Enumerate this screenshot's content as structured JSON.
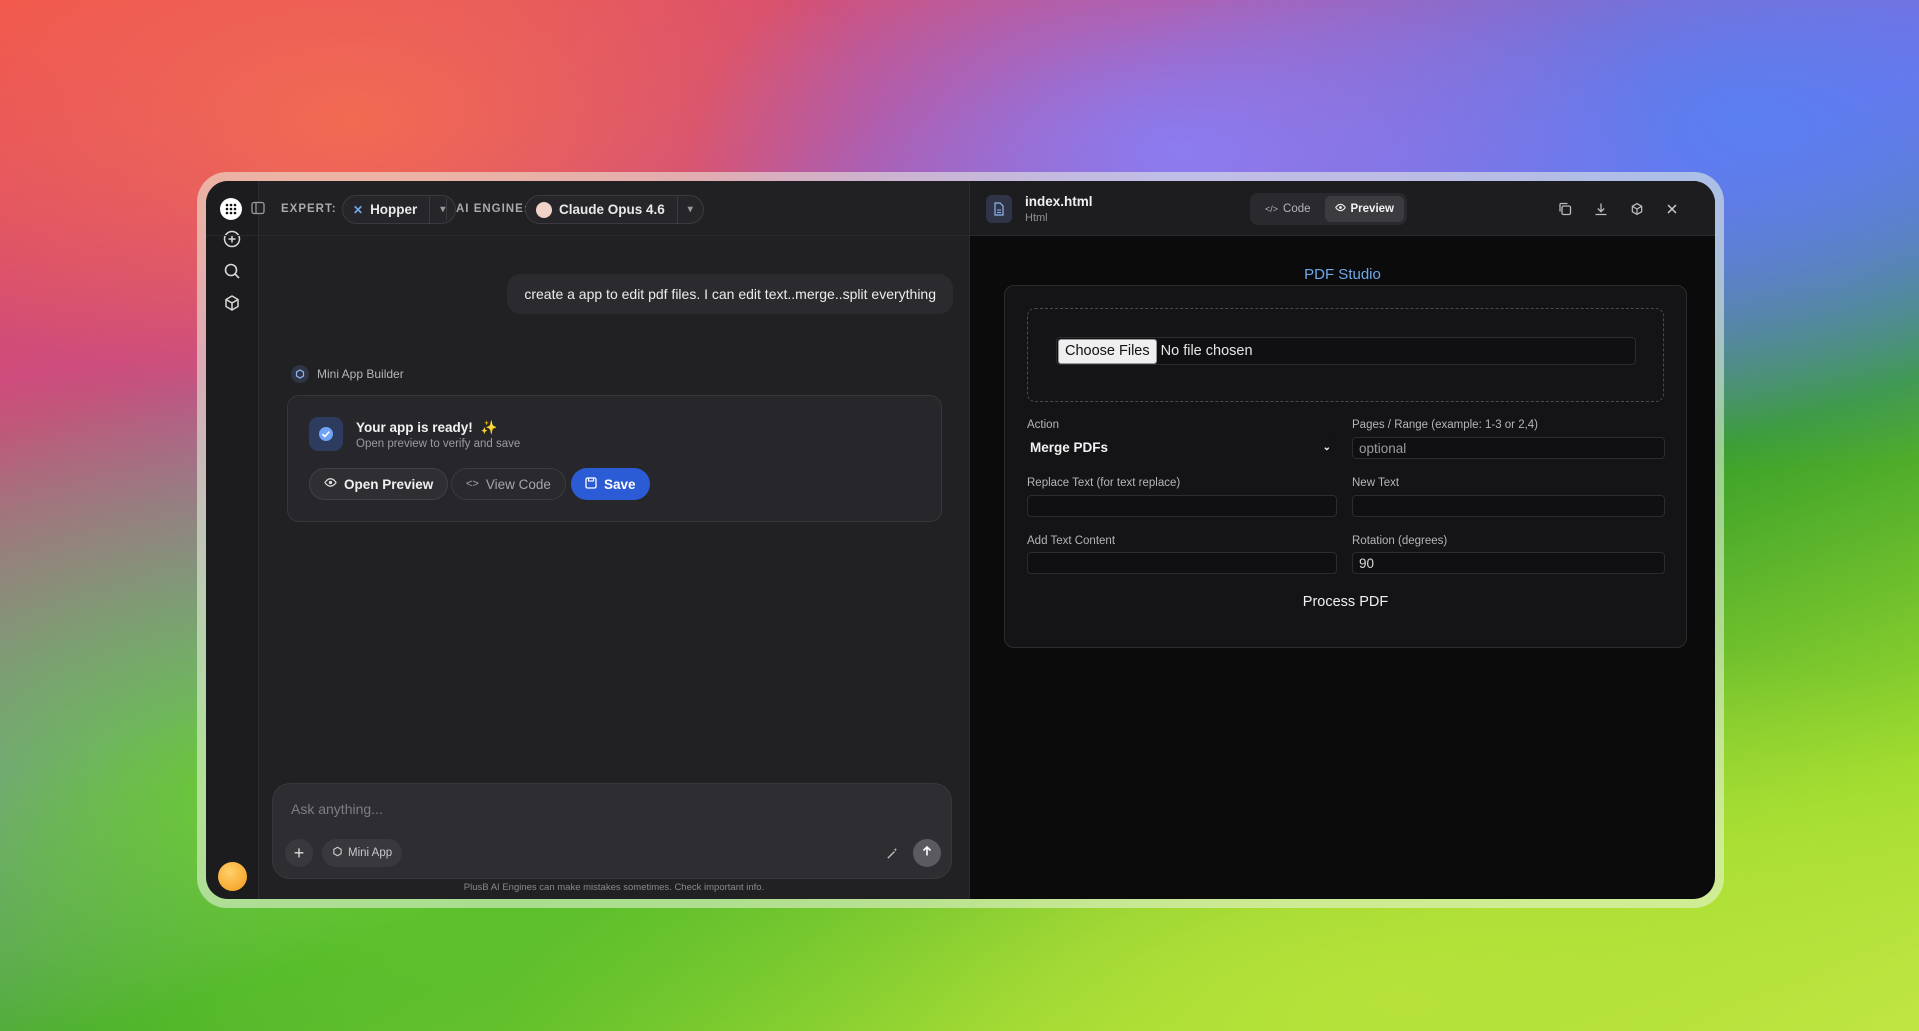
{
  "toolbar": {
    "expert_label": "EXPERT:",
    "expert_value": "Hopper",
    "engine_label": "AI ENGINE:",
    "engine_value": "Claude Opus 4.6"
  },
  "chat": {
    "user_message": "create a app to edit pdf files. I can edit text..merge..split everything",
    "bot_name": "Mini App Builder",
    "card": {
      "title": "Your app is ready!",
      "subtitle": "Open preview to verify and save",
      "open_preview": "Open Preview",
      "view_code": "View Code",
      "save": "Save"
    },
    "composer": {
      "placeholder": "Ask anything...",
      "mode_chip": "Mini App"
    },
    "disclaimer": "PlusB AI Engines can make mistakes sometimes. Check important info."
  },
  "preview": {
    "file_name": "index.html",
    "file_type": "Html",
    "tab_code": "Code",
    "tab_preview": "Preview",
    "app": {
      "title": "PDF Studio",
      "choose_files": "Choose Files",
      "no_file": "No file chosen",
      "action_label": "Action",
      "action_value": "Merge PDFs",
      "pages_label": "Pages / Range (example: 1-3 or 2,4)",
      "pages_placeholder": "optional",
      "replace_label": "Replace Text (for text replace)",
      "replace_value": "",
      "new_text_label": "New Text",
      "new_text_value": "",
      "add_text_label": "Add Text Content",
      "add_text_value": "",
      "rotation_label": "Rotation (degrees)",
      "rotation_value": "90",
      "process_button": "Process PDF"
    }
  },
  "colors": {
    "accent_blue": "#2c5bd6",
    "title_blue": "#6fa8e8"
  }
}
